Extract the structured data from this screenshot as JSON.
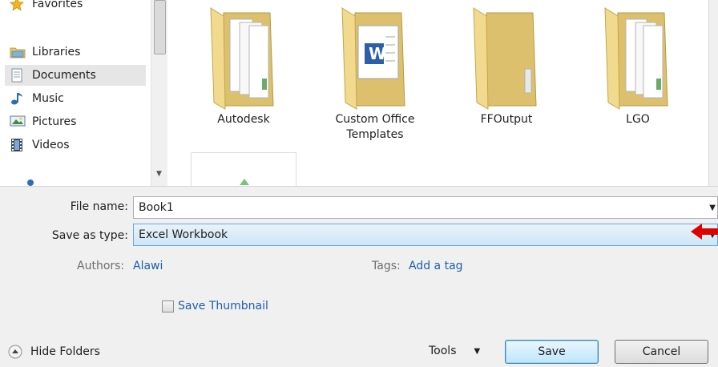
{
  "nav": {
    "favorites_label": "Favorites",
    "libraries_label": "Libraries",
    "items": [
      {
        "label": "Documents",
        "icon": "documents-icon"
      },
      {
        "label": "Music",
        "icon": "music-icon"
      },
      {
        "label": "Pictures",
        "icon": "pictures-icon"
      },
      {
        "label": "Videos",
        "icon": "videos-icon"
      }
    ]
  },
  "folders": [
    {
      "label": "Autodesk"
    },
    {
      "label": "Custom Office Templates"
    },
    {
      "label": "FFOutput"
    },
    {
      "label": "LGO"
    }
  ],
  "form": {
    "filename_label": "File name:",
    "filename_value": "Book1",
    "savetype_label": "Save as type:",
    "savetype_value": "Excel Workbook",
    "authors_label": "Authors:",
    "authors_value": "Alawi",
    "tags_label": "Tags:",
    "tags_value": "Add a tag",
    "thumbnail_label": "Save Thumbnail"
  },
  "footer": {
    "hide_folders_label": "Hide Folders",
    "tools_label": "Tools",
    "save_label": "Save",
    "cancel_label": "Cancel"
  },
  "colors": {
    "annotation_arrow": "#e00000",
    "link": "#1c5fa8",
    "selection": "#cde6f7"
  }
}
